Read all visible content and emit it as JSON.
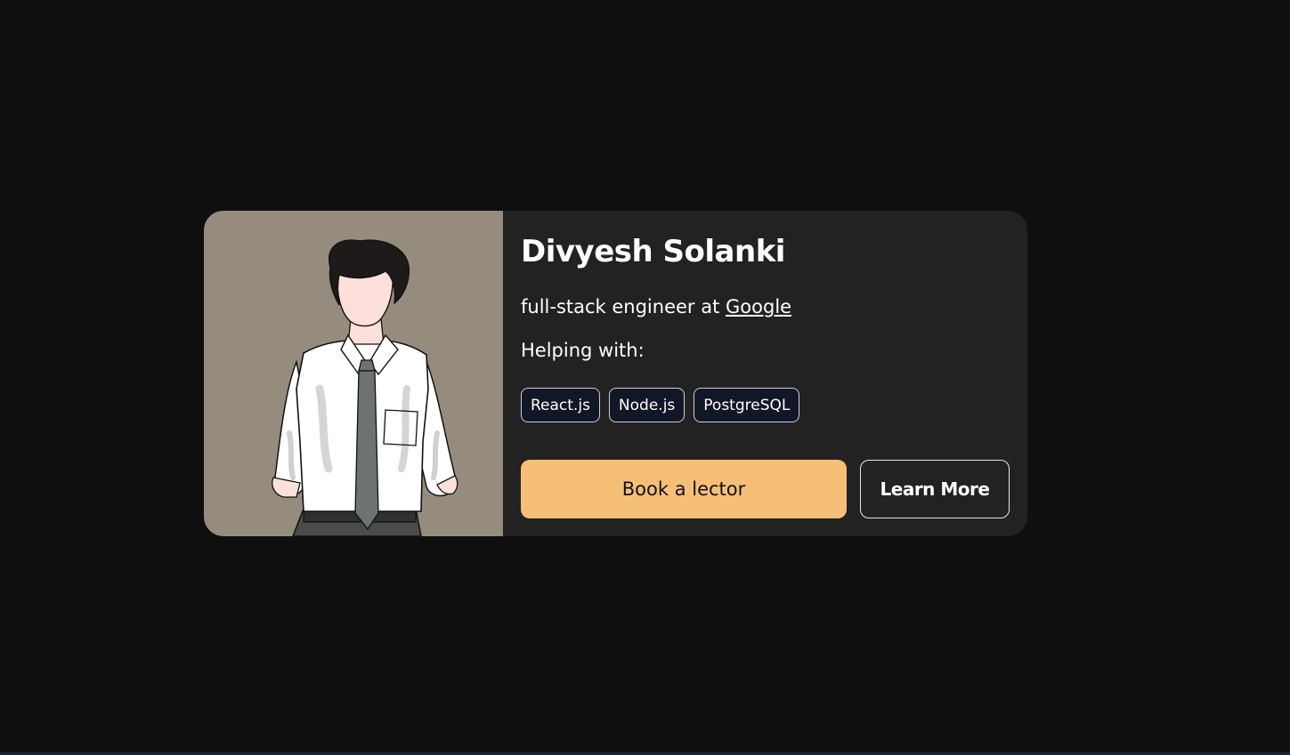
{
  "profile": {
    "name": "Divyesh Solanki",
    "role_prefix": "full-stack engineer at ",
    "company": "Google",
    "helping_label": "Helping with:",
    "avatar": "illustrated-man-portrait"
  },
  "tags": [
    "React.js",
    "Node.js",
    "PostgreSQL"
  ],
  "actions": {
    "primary_label": "Book a lector",
    "secondary_label": "Learn More"
  },
  "colors": {
    "page_background": "#0f0f0f",
    "card_background": "#222222",
    "photo_background": "#958c7d",
    "accent": "#f6bf77",
    "tag_background": "#111726"
  }
}
